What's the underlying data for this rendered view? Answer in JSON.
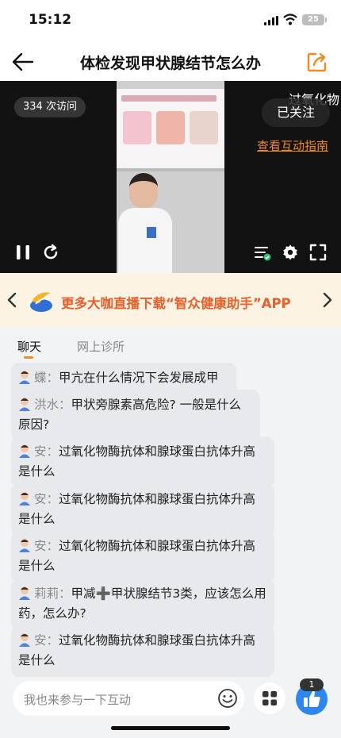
{
  "status_bar": {
    "time": "15:12",
    "battery": "25"
  },
  "header": {
    "title": "体检发现甲状腺结节怎么办",
    "back_icon": "back-arrow-icon",
    "share_icon": "share-icon"
  },
  "video": {
    "visits": "334 次访问",
    "scroll_text": "过氧化物",
    "follow_label": "已关注",
    "guide_link": "查看互动指南",
    "controls": [
      "pause-icon",
      "refresh-icon",
      "subtitle-icon",
      "settings-icon",
      "fullscreen-icon"
    ]
  },
  "banner": {
    "text": "更多大咖直播下载“智众健康助手”APP",
    "logo": "app-logo-icon"
  },
  "tabs": [
    {
      "label": "聊天",
      "active": true
    },
    {
      "label": "网上诊所",
      "active": false
    }
  ],
  "messages": [
    {
      "name": "蝶",
      "text": "甲亢在什么情况下会发展成甲减"
    },
    {
      "name": "洪水",
      "text": "甲状旁腺素高危险? 一般是什么原因?"
    },
    {
      "name": "安",
      "text": "过氧化物酶抗体和腺球蛋白抗体升高是什么"
    },
    {
      "name": "安",
      "text": "过氧化物酶抗体和腺球蛋白抗体升高是什么"
    },
    {
      "name": "安",
      "text": "过氧化物酶抗体和腺球蛋白抗体升高是什么"
    },
    {
      "name": "莉莉",
      "text": "甲减➕甲状腺结节3类，应该怎么用药，怎么办?"
    },
    {
      "name": "安",
      "text": "过氧化物酶抗体和腺球蛋白抗体升高是什么"
    }
  ],
  "input": {
    "placeholder": "我也来参与一下互动"
  },
  "like": {
    "count": "1"
  },
  "colors": {
    "accent": "#f08a24",
    "banner_text": "#e8602c",
    "like_blue": "#2e86f0"
  }
}
